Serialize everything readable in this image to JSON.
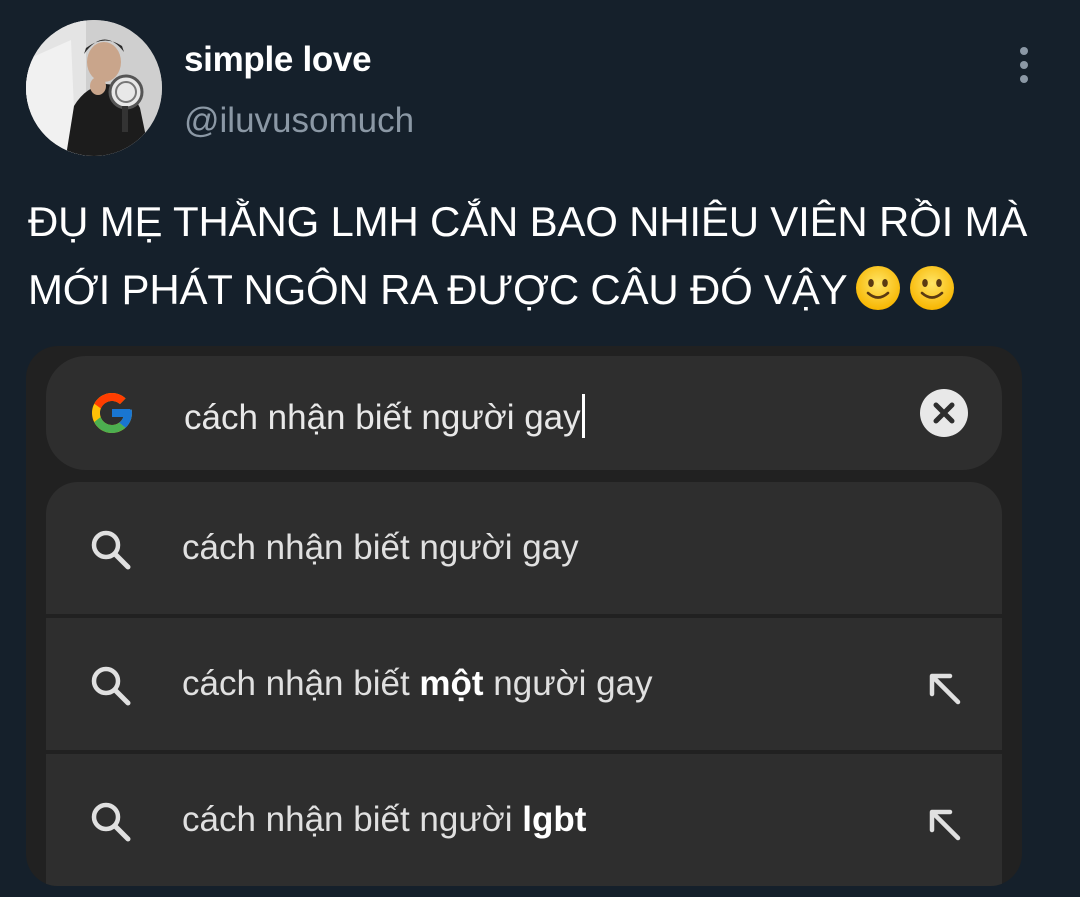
{
  "author": {
    "display_name": "simple love",
    "handle": "@iluvusomuch",
    "avatar_icon": "profile-photo"
  },
  "more_icon": "more-vertical-icon",
  "tweet": {
    "line1": "ĐỤ MẸ THẰNG LMH CẮN BAO NHIÊU VIÊN RỒI MÀ",
    "line2": "MỚI PHÁT NGÔN RA ĐƯỢC CÂU ĐÓ VẬY",
    "emojis": [
      "slightly-smiling-face-emoji",
      "slightly-smiling-face-emoji"
    ]
  },
  "search": {
    "logo_icon": "google-g-icon",
    "query": "cách nhận biết người gay",
    "clear_icon": "close-circle-icon"
  },
  "suggestions": [
    {
      "prefix": "cách nhận biết người gay",
      "bold": "",
      "suffix": "",
      "has_arrow": false
    },
    {
      "prefix": "cách nhận biết ",
      "bold": "một",
      "suffix": " người gay",
      "has_arrow": true
    },
    {
      "prefix": "cách nhận biết người ",
      "bold": "lgbt",
      "suffix": "",
      "has_arrow": true
    }
  ],
  "colors": {
    "background": "#15202b",
    "secondary_text": "#8b98a5",
    "media_bg": "#212121",
    "field_bg": "#2e2e2e"
  }
}
